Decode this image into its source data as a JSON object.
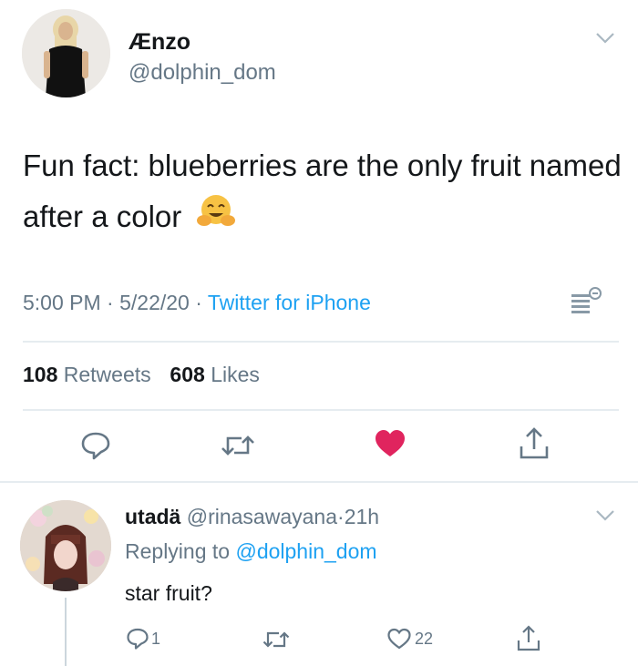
{
  "tweet": {
    "display_name": "Ænzo",
    "handle": "@dolphin_dom",
    "text": "Fun fact: blueberries are the only fruit named after a color",
    "emoji": "hugging-face-emoji",
    "time": "5:00 PM",
    "date": "5/22/20",
    "source": "Twitter for iPhone",
    "retweets": "108",
    "retweets_label": "Retweets",
    "likes": "608",
    "likes_label": "Likes",
    "separator": "·",
    "liked": true,
    "like_color": "#e0245e"
  },
  "reply": {
    "display_name": "utadä",
    "handle": "@rinasawayana",
    "age": "21h",
    "replying_prefix": "Replying to",
    "replying_to": "@dolphin_dom",
    "text": "star fruit?",
    "reply_count": "1",
    "like_count": "22"
  },
  "colors": {
    "link": "#1da1f2",
    "secondary_text": "#657786",
    "primary_text": "#14171a",
    "divider": "#e6ecf0",
    "like": "#e0245e"
  }
}
